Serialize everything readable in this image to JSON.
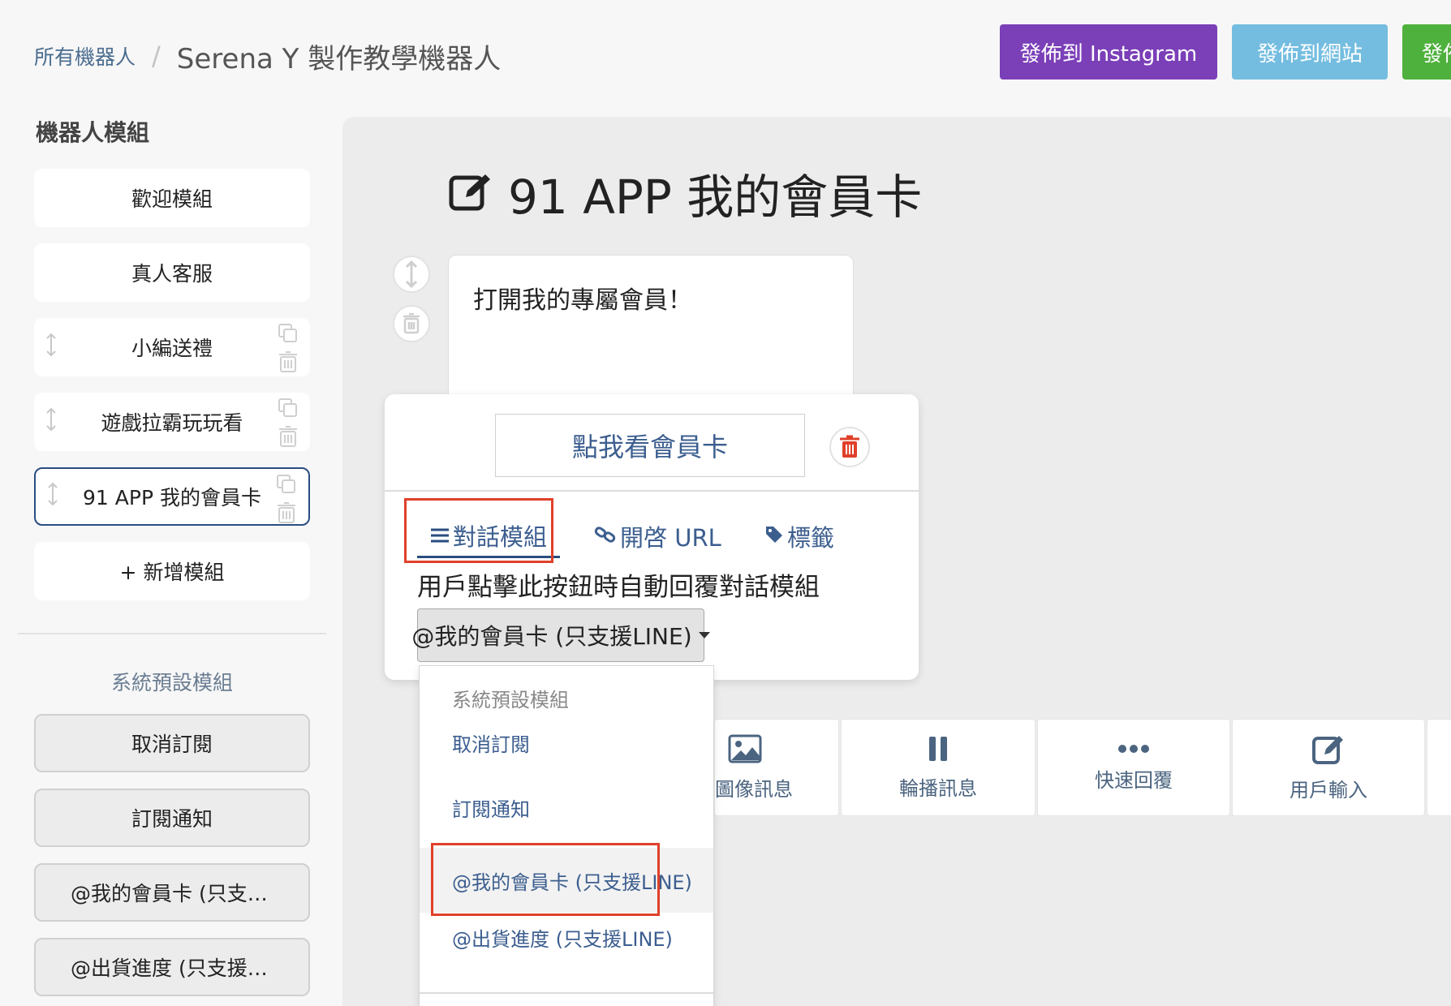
{
  "header": {
    "breadcrumb_root": "所有機器人",
    "breadcrumb_separator": "/",
    "bot_name": "Serena Y 製作教學機器人",
    "publish_instagram": "發佈到 Instagram",
    "publish_website": "發佈到網站",
    "publish_third": "發佈",
    "colors": {
      "instagram": "#7b3fb8",
      "website": "#74bde0",
      "third": "#4fb13d"
    }
  },
  "sidebar": {
    "heading": "機器人模組",
    "modules": [
      {
        "label": "歡迎模組"
      },
      {
        "label": "真人客服"
      },
      {
        "label": "小編送禮"
      },
      {
        "label": "遊戲拉霸玩玩看"
      },
      {
        "label": "91 APP 我的會員卡",
        "active": true
      }
    ],
    "add_module": "+ 新增模組",
    "system_heading": "系統預設模組",
    "system_modules": [
      {
        "label": "取消訂閱"
      },
      {
        "label": "訂閱通知"
      },
      {
        "label": "@我的會員卡 (只支援LINE)"
      },
      {
        "label": "@出貨進度 (只支援LINE)"
      }
    ]
  },
  "main": {
    "title": "91 APP 我的會員卡",
    "message_text": "打開我的專屬會員！",
    "button_editor": {
      "button_label": "點我看會員卡",
      "tabs": {
        "dialog": "對話模組",
        "url": "開啓 URL",
        "tag": "標籤"
      },
      "hint": "用戶點擊此按鈕時自動回覆對話模組",
      "selected_module": "@我的會員卡 (只支援LINE)"
    },
    "dropdown": {
      "header": "系統預設模組",
      "options": [
        "取消訂閱",
        "訂閱通知",
        "@我的會員卡 (只支援LINE)",
        "@出貨進度 (只支援LINE)"
      ]
    },
    "message_types": {
      "image": "圖像訊息",
      "carousel": "輪播訊息",
      "quick_reply": "快速回覆",
      "user_input": "用戶輸入"
    }
  },
  "colors": {
    "accent": "#2a4d80",
    "link": "#3c5e8f",
    "highlight": "#e0402a",
    "delete": "#e0402a"
  }
}
